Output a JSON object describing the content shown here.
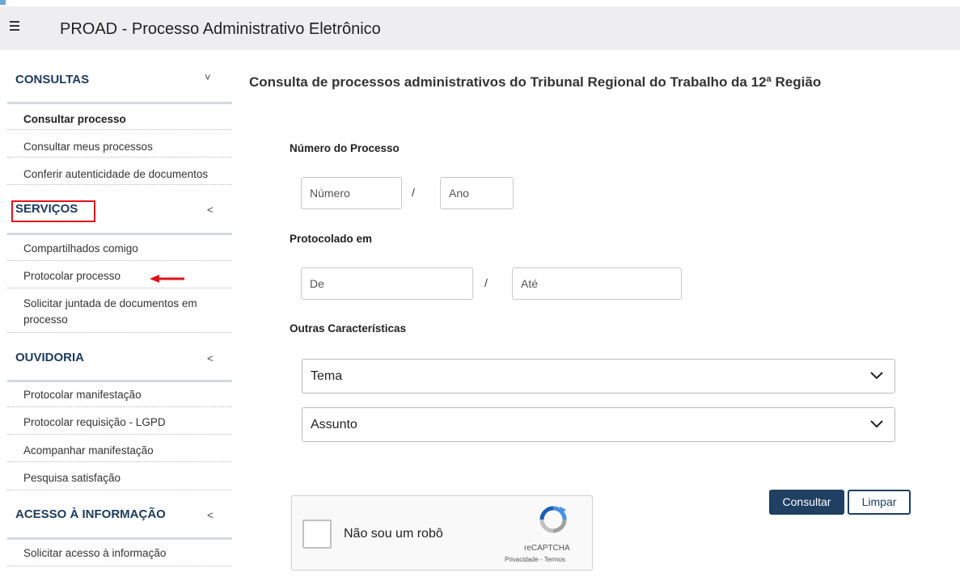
{
  "header": {
    "title": "PROAD - Processo Administrativo Eletrônico",
    "menu_icon": "hamburger-menu-icon"
  },
  "sidebar": {
    "consultas": {
      "label": "CONSULTAS",
      "chevron": "˅",
      "items": [
        "Consultar processo",
        "Consultar meus processos",
        "Conferir autenticidade de documentos"
      ]
    },
    "servicos": {
      "label": "SERVIÇOS",
      "chevron": "<",
      "items": [
        "Compartilhados comigo",
        "Protocolar processo",
        "Solicitar juntada de documentos em processo"
      ]
    },
    "ouvidoria": {
      "label": "OUVIDORIA",
      "chevron": "<",
      "items": [
        "Protocolar manifestação",
        "Protocolar requisição - LGPD",
        "Acompanhar manifestação",
        "Pesquisa satisfação"
      ]
    },
    "acesso": {
      "label": "ACESSO À INFORMAÇÃO",
      "chevron": "<",
      "items": [
        "Solicitar acesso à informação"
      ]
    }
  },
  "annotation": {
    "highlight_color": "#e0121a",
    "arrow_icon": "red-arrow-left-icon"
  },
  "main": {
    "title": "Consulta de processos administrativos do Tribunal Regional do Trabalho da 12ª Região",
    "numero": {
      "label": "Número do Processo",
      "numero_placeholder": "Número",
      "separator": "/",
      "ano_placeholder": "Ano"
    },
    "protocolado": {
      "label": "Protocolado em",
      "de_placeholder": "De",
      "separator": "/",
      "ate_placeholder": "Até"
    },
    "outras": {
      "label": "Outras Características",
      "tema": "Tema",
      "assunto": "Assunto"
    },
    "recaptcha": {
      "text": "Não sou um robô",
      "brand": "reCAPTCHA",
      "links": "Privacidade - Termos"
    },
    "buttons": {
      "consultar": "Consultar",
      "limpar": "Limpar"
    }
  },
  "colors": {
    "accent": "#1f3f63",
    "section_heading": "#1c3a5d",
    "topbar_bg": "#eeeef0"
  }
}
